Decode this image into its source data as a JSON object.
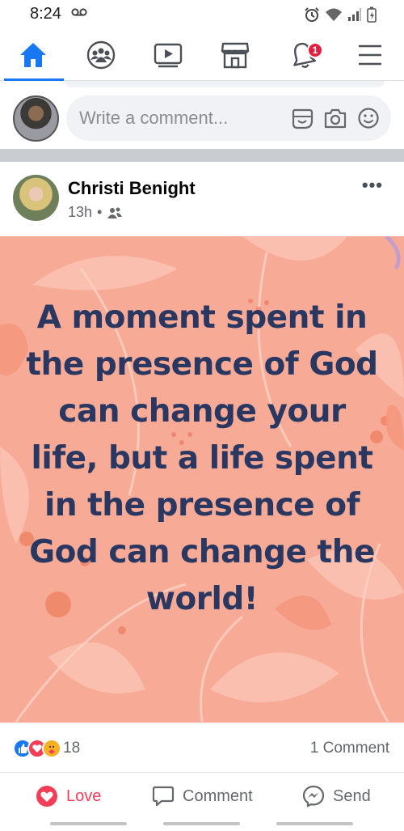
{
  "status_bar": {
    "time": "8:24"
  },
  "nav": {
    "tabs": [
      {
        "name": "home",
        "active": true
      },
      {
        "name": "groups"
      },
      {
        "name": "watch"
      },
      {
        "name": "marketplace"
      },
      {
        "name": "notifications",
        "badge": "1"
      },
      {
        "name": "menu"
      }
    ]
  },
  "comment_bar": {
    "placeholder": "Write a comment..."
  },
  "post": {
    "author": "Christi Benight",
    "time": "13h",
    "audience": "friends-icon",
    "quote": "A moment spent in the presence of God can change your life, but a life spent in the presence of God can change the world!",
    "reaction_count": "18",
    "comment_count": "1 Comment",
    "reaction_types": [
      "like",
      "love",
      "care"
    ]
  },
  "actions": {
    "love": "Love",
    "comment": "Comment",
    "send": "Send"
  },
  "colors": {
    "accent": "#1877f2",
    "love": "#f33e58",
    "post_bg": "#f7ab97",
    "quote_text": "#2a3761",
    "badge": "#e41e3f"
  }
}
